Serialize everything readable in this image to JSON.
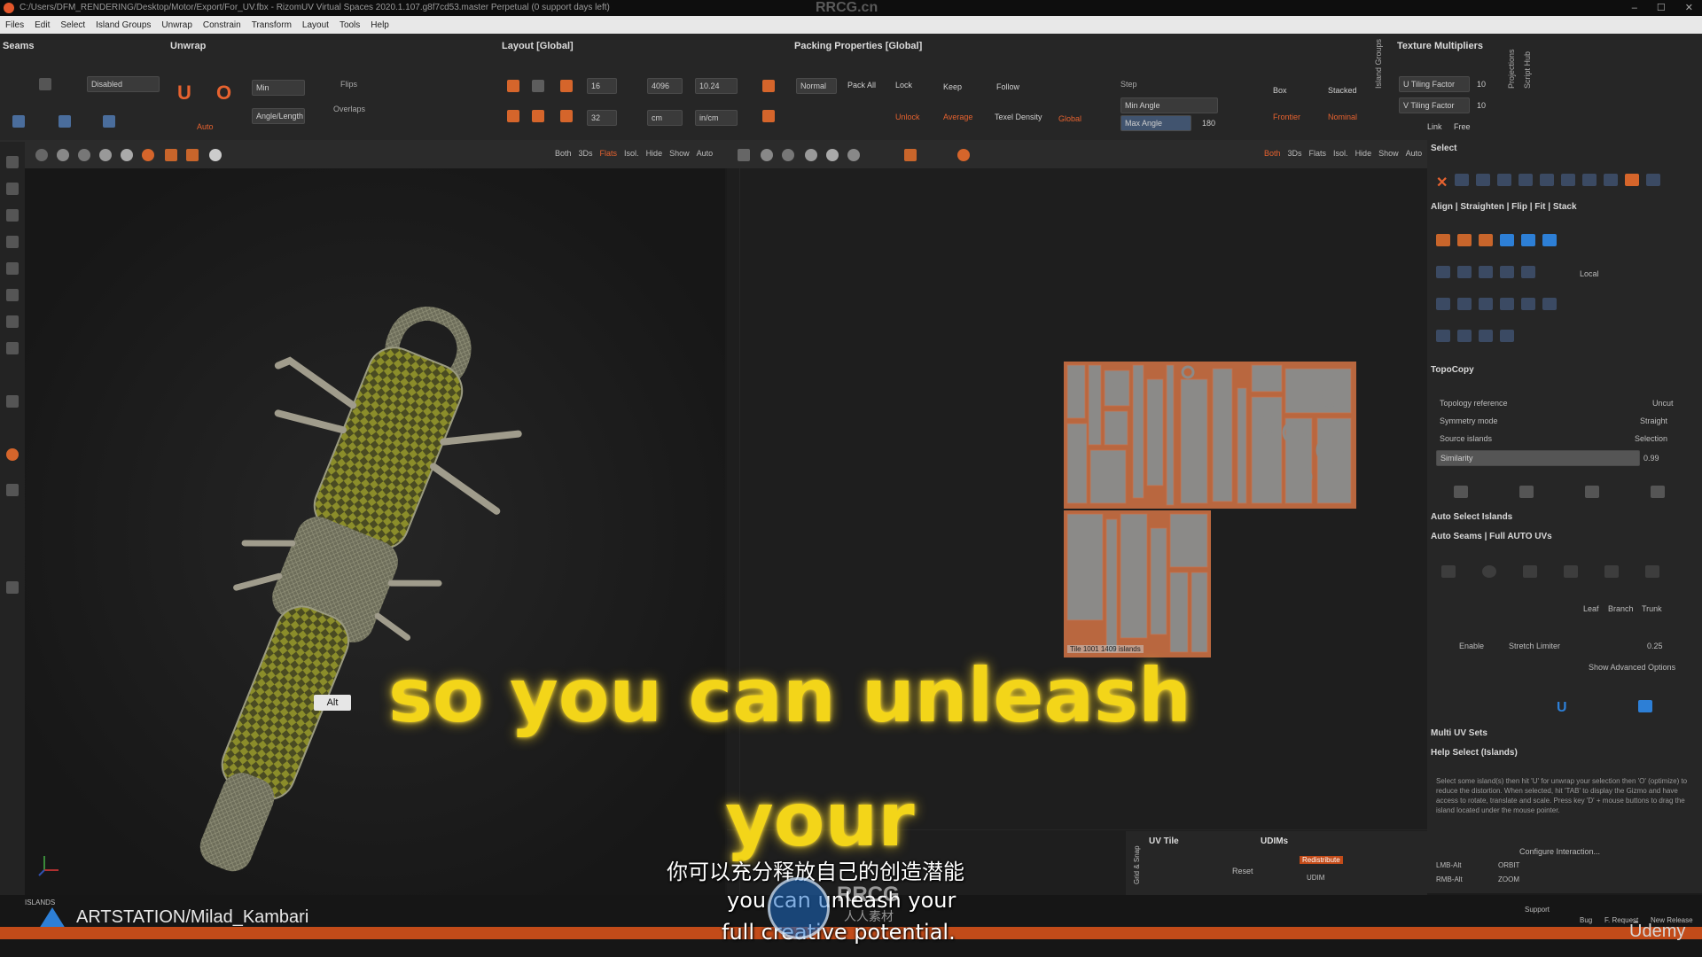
{
  "window": {
    "title": "C:/Users/DFM_RENDERING/Desktop/Motor/Export/For_UV.fbx - RizomUV  Virtual Spaces 2020.1.107.g8f7cd53.master Perpetual  (0 support days left)",
    "watermark": "RRCG.cn"
  },
  "menu": [
    "Files",
    "Edit",
    "Select",
    "Island Groups",
    "Unwrap",
    "Constrain",
    "Transform",
    "Layout",
    "Tools",
    "Help"
  ],
  "panels": {
    "seams": "Seams",
    "unwrap": "Unwrap",
    "layout": "Layout [Global]",
    "packing": "Packing Properties [Global]",
    "texture_mult": "Texture Multipliers",
    "island_groups": "Island Groups",
    "projections": "Projections",
    "script_hub": "Script Hub"
  },
  "toolbar": {
    "disabled": "Disabled",
    "min": "Min",
    "angle_length": "Angle/Length",
    "flips": "Flips",
    "overlaps": "Overlaps",
    "auto": "Auto",
    "margin_val": "16",
    "map_res": "4096",
    "target": "10.24",
    "spacing_val": "32",
    "unit": "cm",
    "scene_unit": "in/cm",
    "normal": "Normal",
    "pack_all": "Pack All",
    "lock": "Lock",
    "keep": "Keep",
    "follow": "Follow",
    "average": "Average",
    "texel_density": "Texel Density",
    "unlock": "Unlock",
    "global": "Global",
    "step": "Step",
    "min_angle": "Min Angle",
    "max_angle": "Max Angle",
    "max_angle_val": "180",
    "tiling_u": "U Tiling Factor",
    "tiling_v": "V Tiling Factor",
    "tiling_val": "10",
    "link": "Link",
    "free": "Free",
    "box": "Box",
    "stacked": "Stacked",
    "frontier": "Frontier",
    "nominal": "Nominal"
  },
  "viewport": {
    "tabs_3d": [
      "Both",
      "3Ds",
      "Flats",
      "Isol.",
      "Hide",
      "Show",
      "Auto"
    ],
    "tabs_uv": [
      "Both",
      "3Ds",
      "Flats",
      "Isol.",
      "Hide",
      "Show",
      "Auto"
    ],
    "alt_key": "Alt",
    "tile_label": "Tile 1001 1409 islands"
  },
  "right_panel": {
    "select": "Select",
    "align": "Align | Straighten | Flip | Fit | Stack",
    "local": "Local",
    "topocopy": "TopoCopy",
    "topology_reference": "Topology reference",
    "uncut": "Uncut",
    "symmetry_mode": "Symmetry mode",
    "straight": "Straight",
    "source_islands": "Source islands",
    "selection": "Selection",
    "similarity": "Similarity",
    "similarity_val": "0.99",
    "auto_select": "Auto Select Islands",
    "auto_seams": "Auto Seams | Full AUTO UVs",
    "leaf": "Leaf",
    "branch": "Branch",
    "trunk": "Trunk",
    "enable": "Enable",
    "stretch_limiter": "Stretch Limiter",
    "stretch_val": "0.25",
    "show_advanced": "Show Advanced Options",
    "multi_uv": "Multi UV Sets",
    "help_select": "Help Select (Islands)",
    "help_text": "Select some island(s) then hit 'U' for unwrap your selection then 'O' (optimize) to reduce the distortion. When selected, hit 'TAB' to display the Gizmo and have access to rotate, translate and scale. Press key 'D' + mouse buttons to drag the island located under the mouse pointer.",
    "configure": "Configure Interaction...",
    "lmb": "LMB-Alt",
    "orbit": "ORBIT",
    "rmb": "RMB-Alt",
    "zoom": "ZOOM"
  },
  "bottom": {
    "uv_tile": "UV Tile",
    "udims": "UDIMs",
    "redistribute": "Redistribute",
    "udim": "UDIM",
    "grid_snap": "Grid & Snap",
    "reset": "Reset",
    "islands": "ISLANDS",
    "artstation": "ARTSTATION/Milad_Kambari",
    "udemy": "Ūdemy",
    "support": "Support",
    "bug": "Bug",
    "feature": "F. Request",
    "new_release": "New Release"
  },
  "captions": {
    "big_line1": "so you can unleash",
    "big_line2": "your",
    "chinese": "你可以充分释放自己的创造潜能",
    "eng_line1": "you can unleash your",
    "eng_line2": "full creative potential.",
    "logo_text": "RRCG",
    "logo_sub": "人人素材"
  }
}
